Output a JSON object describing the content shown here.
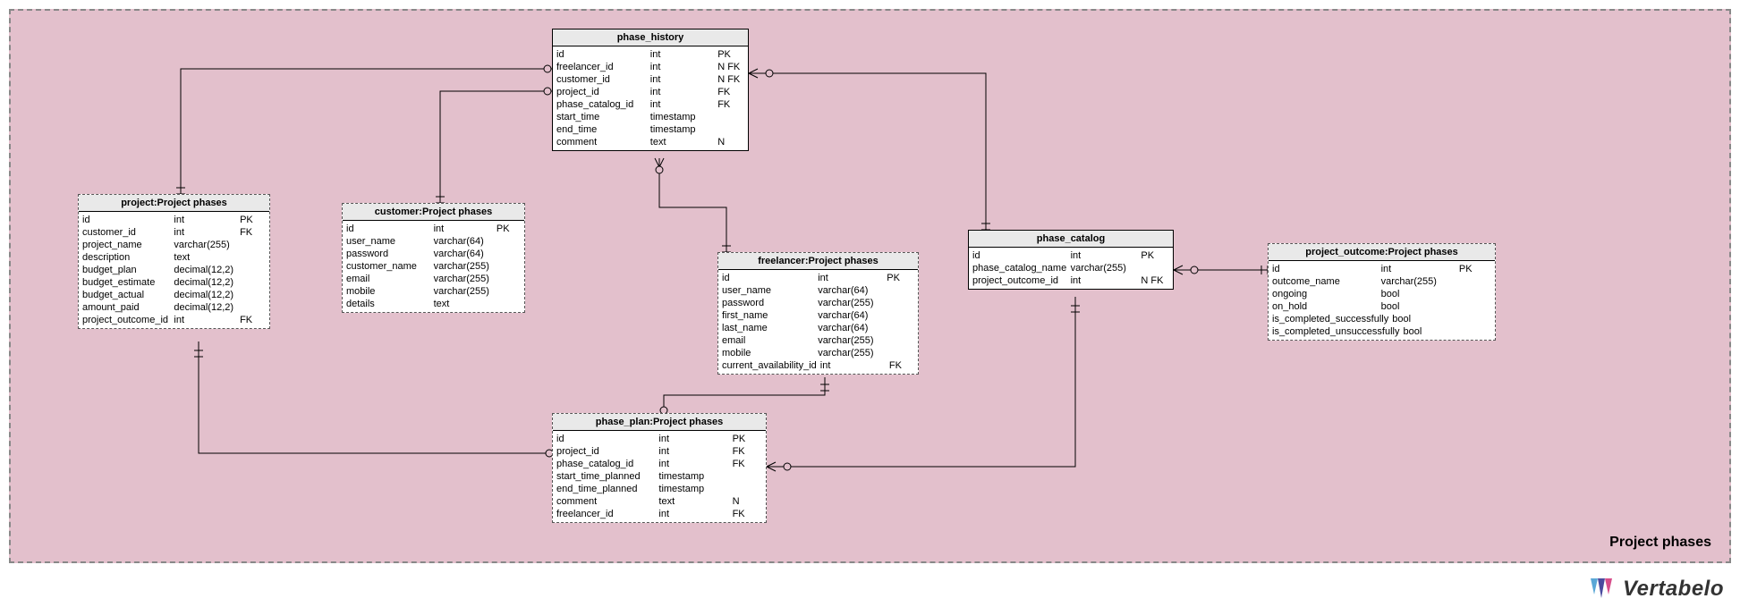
{
  "region_label": "Project phases",
  "logo_text": "Vertabelo",
  "entities": {
    "phase_history": {
      "title": "phase_history",
      "rows": [
        {
          "name": "id",
          "type": "int",
          "flags": "PK"
        },
        {
          "name": "freelancer_id",
          "type": "int",
          "flags": "N FK"
        },
        {
          "name": "customer_id",
          "type": "int",
          "flags": "N FK"
        },
        {
          "name": "project_id",
          "type": "int",
          "flags": "FK"
        },
        {
          "name": "phase_catalog_id",
          "type": "int",
          "flags": "FK"
        },
        {
          "name": "start_time",
          "type": "timestamp",
          "flags": ""
        },
        {
          "name": "end_time",
          "type": "timestamp",
          "flags": ""
        },
        {
          "name": "comment",
          "type": "text",
          "flags": "N"
        }
      ]
    },
    "project": {
      "title": "project:Project phases",
      "rows": [
        {
          "name": "id",
          "type": "int",
          "flags": "PK"
        },
        {
          "name": "customer_id",
          "type": "int",
          "flags": "FK"
        },
        {
          "name": "project_name",
          "type": "varchar(255)",
          "flags": ""
        },
        {
          "name": "description",
          "type": "text",
          "flags": ""
        },
        {
          "name": "budget_plan",
          "type": "decimal(12,2)",
          "flags": ""
        },
        {
          "name": "budget_estimate",
          "type": "decimal(12,2)",
          "flags": ""
        },
        {
          "name": "budget_actual",
          "type": "decimal(12,2)",
          "flags": ""
        },
        {
          "name": "amount_paid",
          "type": "decimal(12,2)",
          "flags": ""
        },
        {
          "name": "project_outcome_id",
          "type": "int",
          "flags": "FK"
        }
      ]
    },
    "customer": {
      "title": "customer:Project phases",
      "rows": [
        {
          "name": "id",
          "type": "int",
          "flags": "PK"
        },
        {
          "name": "user_name",
          "type": "varchar(64)",
          "flags": ""
        },
        {
          "name": "password",
          "type": "varchar(64)",
          "flags": ""
        },
        {
          "name": "customer_name",
          "type": "varchar(255)",
          "flags": ""
        },
        {
          "name": "email",
          "type": "varchar(255)",
          "flags": ""
        },
        {
          "name": "mobile",
          "type": "varchar(255)",
          "flags": ""
        },
        {
          "name": "details",
          "type": "text",
          "flags": ""
        }
      ]
    },
    "freelancer": {
      "title": "freelancer:Project phases",
      "rows": [
        {
          "name": "id",
          "type": "int",
          "flags": "PK"
        },
        {
          "name": "user_name",
          "type": "varchar(64)",
          "flags": ""
        },
        {
          "name": "password",
          "type": "varchar(255)",
          "flags": ""
        },
        {
          "name": "first_name",
          "type": "varchar(64)",
          "flags": ""
        },
        {
          "name": "last_name",
          "type": "varchar(64)",
          "flags": ""
        },
        {
          "name": "email",
          "type": "varchar(255)",
          "flags": ""
        },
        {
          "name": "mobile",
          "type": "varchar(255)",
          "flags": ""
        },
        {
          "name": "current_availability_id",
          "type": "int",
          "flags": "FK"
        }
      ]
    },
    "phase_catalog": {
      "title": "phase_catalog",
      "rows": [
        {
          "name": "id",
          "type": "int",
          "flags": "PK"
        },
        {
          "name": "phase_catalog_name",
          "type": "varchar(255)",
          "flags": ""
        },
        {
          "name": "project_outcome_id",
          "type": "int",
          "flags": "N FK"
        }
      ]
    },
    "project_outcome": {
      "title": "project_outcome:Project phases",
      "rows": [
        {
          "name": "id",
          "type": "int",
          "flags": "PK"
        },
        {
          "name": "outcome_name",
          "type": "varchar(255)",
          "flags": ""
        },
        {
          "name": "ongoing",
          "type": "bool",
          "flags": ""
        },
        {
          "name": "on_hold",
          "type": "bool",
          "flags": ""
        },
        {
          "name": "is_completed_successfully",
          "type": "bool",
          "flags": ""
        },
        {
          "name": "is_completed_unsuccessfully",
          "type": "bool",
          "flags": ""
        }
      ]
    },
    "phase_plan": {
      "title": "phase_plan:Project phases",
      "rows": [
        {
          "name": "id",
          "type": "int",
          "flags": "PK"
        },
        {
          "name": "project_id",
          "type": "int",
          "flags": "FK"
        },
        {
          "name": "phase_catalog_id",
          "type": "int",
          "flags": "FK"
        },
        {
          "name": "start_time_planned",
          "type": "timestamp",
          "flags": ""
        },
        {
          "name": "end_time_planned",
          "type": "timestamp",
          "flags": ""
        },
        {
          "name": "comment",
          "type": "text",
          "flags": "N"
        },
        {
          "name": "freelancer_id",
          "type": "int",
          "flags": "FK"
        }
      ]
    }
  },
  "chart_data": {
    "type": "erd",
    "region": "Project phases",
    "tables": [
      "phase_history",
      "project",
      "customer",
      "freelancer",
      "phase_catalog",
      "project_outcome",
      "phase_plan"
    ],
    "relations": [
      {
        "from": "phase_history.freelancer_id",
        "to": "freelancer.id"
      },
      {
        "from": "phase_history.customer_id",
        "to": "customer.id"
      },
      {
        "from": "phase_history.project_id",
        "to": "project.id"
      },
      {
        "from": "phase_history.phase_catalog_id",
        "to": "phase_catalog.id"
      },
      {
        "from": "phase_plan.project_id",
        "to": "project.id"
      },
      {
        "from": "phase_plan.phase_catalog_id",
        "to": "phase_catalog.id"
      },
      {
        "from": "phase_plan.freelancer_id",
        "to": "freelancer.id"
      },
      {
        "from": "phase_catalog.project_outcome_id",
        "to": "project_outcome.id"
      }
    ]
  }
}
